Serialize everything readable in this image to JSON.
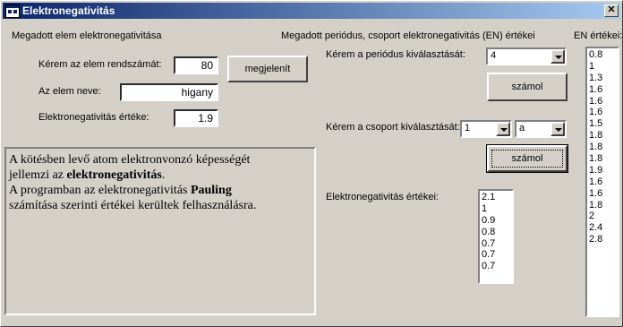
{
  "window": {
    "title": "Elektronegativitás",
    "close_label": "✕"
  },
  "left": {
    "heading": "Megadott elem elektronegativitása",
    "atomic_number_label": "Kérem az elem rendszámát:",
    "atomic_number_value": "80",
    "show_button": "megjelenít",
    "element_name_label": "Az elem neve:",
    "element_name_value": "higany",
    "en_value_label": "Elektronegativitás értéke:",
    "en_value": "1.9"
  },
  "info": {
    "line1": "A kötésben levő atom elektronvonzó képességét",
    "line2_prefix": "jellemzi az ",
    "line2_bold": "elektronegativitás",
    "line2_suffix": ".",
    "line3_prefix": "A programban az elektronegativitás ",
    "line3_bold": "Pauling",
    "line4": " számítása szerinti értékei kerültek felhasználásra."
  },
  "middle": {
    "heading": "Megadott periódus, csoport elektronegativitás (EN) értékei",
    "period_label": "Kérem a periódus kiválasztását:",
    "period_value": "4",
    "calc_button_1": "számol",
    "group_label": "Kérem a csoport kiválasztását:",
    "group_value": "1",
    "subgroup_value": "a",
    "calc_button_2": "számol",
    "en_values_label": "Elektronegativitás értékei:",
    "en_values": [
      "2.1",
      "1",
      "0.9",
      "0.8",
      "0.7",
      "0.7",
      "0.7"
    ]
  },
  "right": {
    "heading": "EN értékei:",
    "values": [
      "0.8",
      "1",
      "1.3",
      "1.6",
      "1.6",
      "1.6",
      "1.5",
      "1.8",
      "1.8",
      "1.8",
      "1.9",
      "1.6",
      "1.6",
      "1.8",
      "2",
      "2.4",
      "2.8"
    ]
  }
}
